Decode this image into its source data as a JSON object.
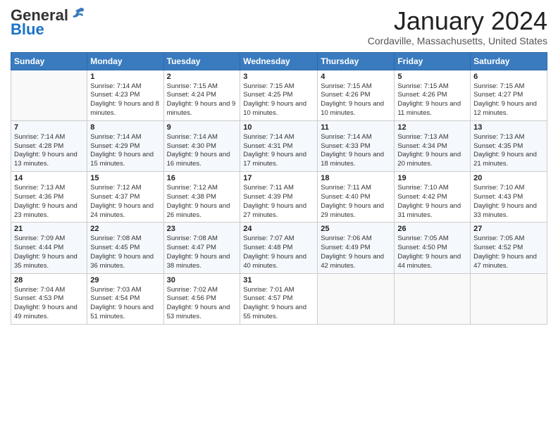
{
  "logo": {
    "general": "General",
    "blue": "Blue"
  },
  "header": {
    "month_title": "January 2024",
    "location": "Cordaville, Massachusetts, United States"
  },
  "weekdays": [
    "Sunday",
    "Monday",
    "Tuesday",
    "Wednesday",
    "Thursday",
    "Friday",
    "Saturday"
  ],
  "weeks": [
    [
      {
        "day": "",
        "sunrise": "",
        "sunset": "",
        "daylight": ""
      },
      {
        "day": "1",
        "sunrise": "Sunrise: 7:14 AM",
        "sunset": "Sunset: 4:23 PM",
        "daylight": "Daylight: 9 hours and 8 minutes."
      },
      {
        "day": "2",
        "sunrise": "Sunrise: 7:15 AM",
        "sunset": "Sunset: 4:24 PM",
        "daylight": "Daylight: 9 hours and 9 minutes."
      },
      {
        "day": "3",
        "sunrise": "Sunrise: 7:15 AM",
        "sunset": "Sunset: 4:25 PM",
        "daylight": "Daylight: 9 hours and 10 minutes."
      },
      {
        "day": "4",
        "sunrise": "Sunrise: 7:15 AM",
        "sunset": "Sunset: 4:26 PM",
        "daylight": "Daylight: 9 hours and 10 minutes."
      },
      {
        "day": "5",
        "sunrise": "Sunrise: 7:15 AM",
        "sunset": "Sunset: 4:26 PM",
        "daylight": "Daylight: 9 hours and 11 minutes."
      },
      {
        "day": "6",
        "sunrise": "Sunrise: 7:15 AM",
        "sunset": "Sunset: 4:27 PM",
        "daylight": "Daylight: 9 hours and 12 minutes."
      }
    ],
    [
      {
        "day": "7",
        "sunrise": "Sunrise: 7:14 AM",
        "sunset": "Sunset: 4:28 PM",
        "daylight": "Daylight: 9 hours and 13 minutes."
      },
      {
        "day": "8",
        "sunrise": "Sunrise: 7:14 AM",
        "sunset": "Sunset: 4:29 PM",
        "daylight": "Daylight: 9 hours and 15 minutes."
      },
      {
        "day": "9",
        "sunrise": "Sunrise: 7:14 AM",
        "sunset": "Sunset: 4:30 PM",
        "daylight": "Daylight: 9 hours and 16 minutes."
      },
      {
        "day": "10",
        "sunrise": "Sunrise: 7:14 AM",
        "sunset": "Sunset: 4:31 PM",
        "daylight": "Daylight: 9 hours and 17 minutes."
      },
      {
        "day": "11",
        "sunrise": "Sunrise: 7:14 AM",
        "sunset": "Sunset: 4:33 PM",
        "daylight": "Daylight: 9 hours and 18 minutes."
      },
      {
        "day": "12",
        "sunrise": "Sunrise: 7:13 AM",
        "sunset": "Sunset: 4:34 PM",
        "daylight": "Daylight: 9 hours and 20 minutes."
      },
      {
        "day": "13",
        "sunrise": "Sunrise: 7:13 AM",
        "sunset": "Sunset: 4:35 PM",
        "daylight": "Daylight: 9 hours and 21 minutes."
      }
    ],
    [
      {
        "day": "14",
        "sunrise": "Sunrise: 7:13 AM",
        "sunset": "Sunset: 4:36 PM",
        "daylight": "Daylight: 9 hours and 23 minutes."
      },
      {
        "day": "15",
        "sunrise": "Sunrise: 7:12 AM",
        "sunset": "Sunset: 4:37 PM",
        "daylight": "Daylight: 9 hours and 24 minutes."
      },
      {
        "day": "16",
        "sunrise": "Sunrise: 7:12 AM",
        "sunset": "Sunset: 4:38 PM",
        "daylight": "Daylight: 9 hours and 26 minutes."
      },
      {
        "day": "17",
        "sunrise": "Sunrise: 7:11 AM",
        "sunset": "Sunset: 4:39 PM",
        "daylight": "Daylight: 9 hours and 27 minutes."
      },
      {
        "day": "18",
        "sunrise": "Sunrise: 7:11 AM",
        "sunset": "Sunset: 4:40 PM",
        "daylight": "Daylight: 9 hours and 29 minutes."
      },
      {
        "day": "19",
        "sunrise": "Sunrise: 7:10 AM",
        "sunset": "Sunset: 4:42 PM",
        "daylight": "Daylight: 9 hours and 31 minutes."
      },
      {
        "day": "20",
        "sunrise": "Sunrise: 7:10 AM",
        "sunset": "Sunset: 4:43 PM",
        "daylight": "Daylight: 9 hours and 33 minutes."
      }
    ],
    [
      {
        "day": "21",
        "sunrise": "Sunrise: 7:09 AM",
        "sunset": "Sunset: 4:44 PM",
        "daylight": "Daylight: 9 hours and 35 minutes."
      },
      {
        "day": "22",
        "sunrise": "Sunrise: 7:08 AM",
        "sunset": "Sunset: 4:45 PM",
        "daylight": "Daylight: 9 hours and 36 minutes."
      },
      {
        "day": "23",
        "sunrise": "Sunrise: 7:08 AM",
        "sunset": "Sunset: 4:47 PM",
        "daylight": "Daylight: 9 hours and 38 minutes."
      },
      {
        "day": "24",
        "sunrise": "Sunrise: 7:07 AM",
        "sunset": "Sunset: 4:48 PM",
        "daylight": "Daylight: 9 hours and 40 minutes."
      },
      {
        "day": "25",
        "sunrise": "Sunrise: 7:06 AM",
        "sunset": "Sunset: 4:49 PM",
        "daylight": "Daylight: 9 hours and 42 minutes."
      },
      {
        "day": "26",
        "sunrise": "Sunrise: 7:05 AM",
        "sunset": "Sunset: 4:50 PM",
        "daylight": "Daylight: 9 hours and 44 minutes."
      },
      {
        "day": "27",
        "sunrise": "Sunrise: 7:05 AM",
        "sunset": "Sunset: 4:52 PM",
        "daylight": "Daylight: 9 hours and 47 minutes."
      }
    ],
    [
      {
        "day": "28",
        "sunrise": "Sunrise: 7:04 AM",
        "sunset": "Sunset: 4:53 PM",
        "daylight": "Daylight: 9 hours and 49 minutes."
      },
      {
        "day": "29",
        "sunrise": "Sunrise: 7:03 AM",
        "sunset": "Sunset: 4:54 PM",
        "daylight": "Daylight: 9 hours and 51 minutes."
      },
      {
        "day": "30",
        "sunrise": "Sunrise: 7:02 AM",
        "sunset": "Sunset: 4:56 PM",
        "daylight": "Daylight: 9 hours and 53 minutes."
      },
      {
        "day": "31",
        "sunrise": "Sunrise: 7:01 AM",
        "sunset": "Sunset: 4:57 PM",
        "daylight": "Daylight: 9 hours and 55 minutes."
      },
      {
        "day": "",
        "sunrise": "",
        "sunset": "",
        "daylight": ""
      },
      {
        "day": "",
        "sunrise": "",
        "sunset": "",
        "daylight": ""
      },
      {
        "day": "",
        "sunrise": "",
        "sunset": "",
        "daylight": ""
      }
    ]
  ]
}
